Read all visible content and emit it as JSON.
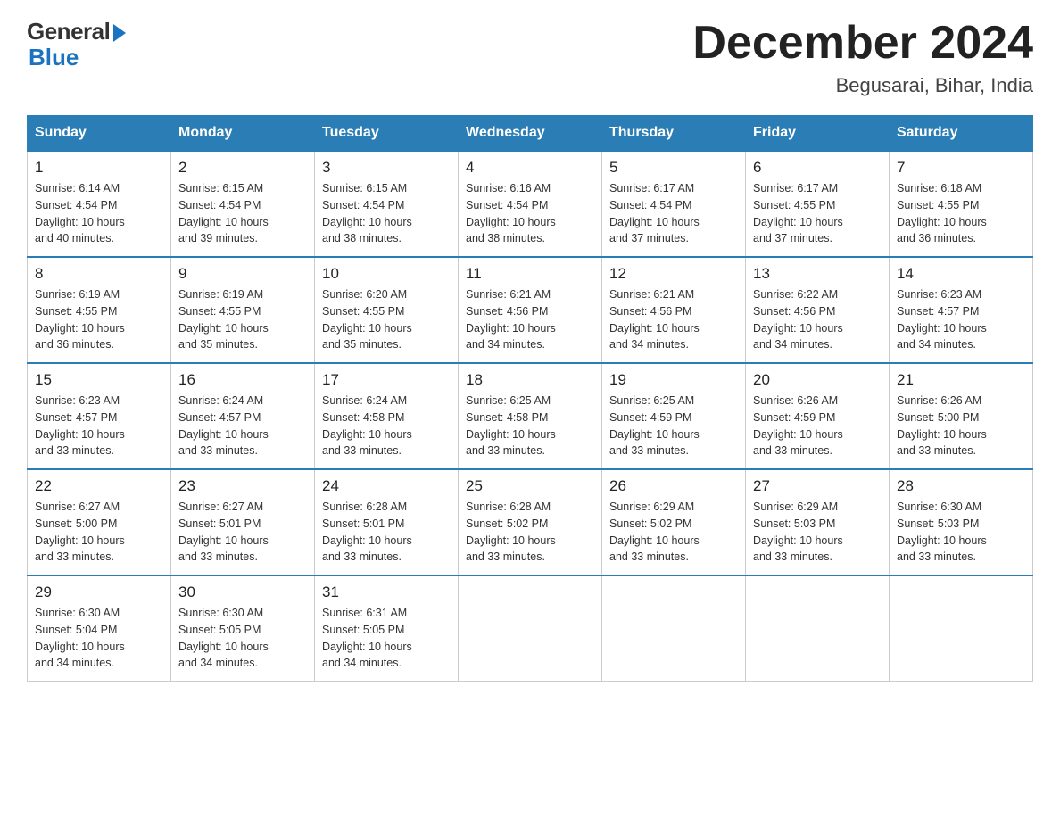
{
  "header": {
    "logo_general": "General",
    "logo_blue": "Blue",
    "month_title": "December 2024",
    "location": "Begusarai, Bihar, India"
  },
  "days_of_week": [
    "Sunday",
    "Monday",
    "Tuesday",
    "Wednesday",
    "Thursday",
    "Friday",
    "Saturday"
  ],
  "weeks": [
    [
      {
        "day": "1",
        "sunrise": "6:14 AM",
        "sunset": "4:54 PM",
        "daylight": "10 hours and 40 minutes."
      },
      {
        "day": "2",
        "sunrise": "6:15 AM",
        "sunset": "4:54 PM",
        "daylight": "10 hours and 39 minutes."
      },
      {
        "day": "3",
        "sunrise": "6:15 AM",
        "sunset": "4:54 PM",
        "daylight": "10 hours and 38 minutes."
      },
      {
        "day": "4",
        "sunrise": "6:16 AM",
        "sunset": "4:54 PM",
        "daylight": "10 hours and 38 minutes."
      },
      {
        "day": "5",
        "sunrise": "6:17 AM",
        "sunset": "4:54 PM",
        "daylight": "10 hours and 37 minutes."
      },
      {
        "day": "6",
        "sunrise": "6:17 AM",
        "sunset": "4:55 PM",
        "daylight": "10 hours and 37 minutes."
      },
      {
        "day": "7",
        "sunrise": "6:18 AM",
        "sunset": "4:55 PM",
        "daylight": "10 hours and 36 minutes."
      }
    ],
    [
      {
        "day": "8",
        "sunrise": "6:19 AM",
        "sunset": "4:55 PM",
        "daylight": "10 hours and 36 minutes."
      },
      {
        "day": "9",
        "sunrise": "6:19 AM",
        "sunset": "4:55 PM",
        "daylight": "10 hours and 35 minutes."
      },
      {
        "day": "10",
        "sunrise": "6:20 AM",
        "sunset": "4:55 PM",
        "daylight": "10 hours and 35 minutes."
      },
      {
        "day": "11",
        "sunrise": "6:21 AM",
        "sunset": "4:56 PM",
        "daylight": "10 hours and 34 minutes."
      },
      {
        "day": "12",
        "sunrise": "6:21 AM",
        "sunset": "4:56 PM",
        "daylight": "10 hours and 34 minutes."
      },
      {
        "day": "13",
        "sunrise": "6:22 AM",
        "sunset": "4:56 PM",
        "daylight": "10 hours and 34 minutes."
      },
      {
        "day": "14",
        "sunrise": "6:23 AM",
        "sunset": "4:57 PM",
        "daylight": "10 hours and 34 minutes."
      }
    ],
    [
      {
        "day": "15",
        "sunrise": "6:23 AM",
        "sunset": "4:57 PM",
        "daylight": "10 hours and 33 minutes."
      },
      {
        "day": "16",
        "sunrise": "6:24 AM",
        "sunset": "4:57 PM",
        "daylight": "10 hours and 33 minutes."
      },
      {
        "day": "17",
        "sunrise": "6:24 AM",
        "sunset": "4:58 PM",
        "daylight": "10 hours and 33 minutes."
      },
      {
        "day": "18",
        "sunrise": "6:25 AM",
        "sunset": "4:58 PM",
        "daylight": "10 hours and 33 minutes."
      },
      {
        "day": "19",
        "sunrise": "6:25 AM",
        "sunset": "4:59 PM",
        "daylight": "10 hours and 33 minutes."
      },
      {
        "day": "20",
        "sunrise": "6:26 AM",
        "sunset": "4:59 PM",
        "daylight": "10 hours and 33 minutes."
      },
      {
        "day": "21",
        "sunrise": "6:26 AM",
        "sunset": "5:00 PM",
        "daylight": "10 hours and 33 minutes."
      }
    ],
    [
      {
        "day": "22",
        "sunrise": "6:27 AM",
        "sunset": "5:00 PM",
        "daylight": "10 hours and 33 minutes."
      },
      {
        "day": "23",
        "sunrise": "6:27 AM",
        "sunset": "5:01 PM",
        "daylight": "10 hours and 33 minutes."
      },
      {
        "day": "24",
        "sunrise": "6:28 AM",
        "sunset": "5:01 PM",
        "daylight": "10 hours and 33 minutes."
      },
      {
        "day": "25",
        "sunrise": "6:28 AM",
        "sunset": "5:02 PM",
        "daylight": "10 hours and 33 minutes."
      },
      {
        "day": "26",
        "sunrise": "6:29 AM",
        "sunset": "5:02 PM",
        "daylight": "10 hours and 33 minutes."
      },
      {
        "day": "27",
        "sunrise": "6:29 AM",
        "sunset": "5:03 PM",
        "daylight": "10 hours and 33 minutes."
      },
      {
        "day": "28",
        "sunrise": "6:30 AM",
        "sunset": "5:03 PM",
        "daylight": "10 hours and 33 minutes."
      }
    ],
    [
      {
        "day": "29",
        "sunrise": "6:30 AM",
        "sunset": "5:04 PM",
        "daylight": "10 hours and 34 minutes."
      },
      {
        "day": "30",
        "sunrise": "6:30 AM",
        "sunset": "5:05 PM",
        "daylight": "10 hours and 34 minutes."
      },
      {
        "day": "31",
        "sunrise": "6:31 AM",
        "sunset": "5:05 PM",
        "daylight": "10 hours and 34 minutes."
      },
      null,
      null,
      null,
      null
    ]
  ],
  "labels": {
    "sunrise": "Sunrise:",
    "sunset": "Sunset:",
    "daylight": "Daylight:"
  }
}
